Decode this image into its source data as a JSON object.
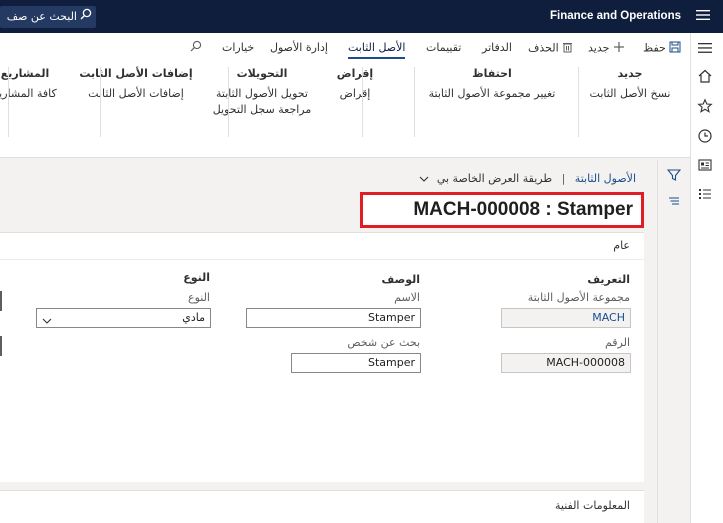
{
  "app": {
    "title": "Finance and Operations",
    "search_label": "البحث عن صف"
  },
  "tabs": [
    {
      "label": "حفظ"
    },
    {
      "label": "جديد"
    },
    {
      "label": "الحذف"
    },
    {
      "label": "الدفاتر"
    },
    {
      "label": "تقييمات"
    },
    {
      "label": "الأصل الثابت"
    },
    {
      "label": "إدارة الأصول"
    },
    {
      "label": "خيارات"
    }
  ],
  "ribbon": {
    "groups": [
      {
        "title": "جديد",
        "items": [
          "نسخ الأصل الثابت"
        ]
      },
      {
        "title": "احتفاظ",
        "items": [
          "تغيير مجموعة الأصول الثابتة"
        ]
      },
      {
        "title": "إقراض",
        "items": [
          "إقراض"
        ]
      },
      {
        "title": "التحويلات",
        "items": [
          "تحويل الأصول الثابتة",
          "مراجعة سجل التحويل"
        ]
      },
      {
        "title": "إضافات الأصل الثابت",
        "items": [
          "إضافات الأصل الثابت"
        ]
      },
      {
        "title": "المشاريع",
        "items": [
          "كافة المشاريع"
        ]
      }
    ]
  },
  "breadcrumb": {
    "root": "الأصول الثابتة",
    "view": "طريقة العرض الخاصة بي"
  },
  "record_title": "MACH-000008 : Stamper",
  "general": {
    "header": "عام",
    "identification": {
      "title": "التعريف",
      "group_label": "مجموعة الأصول الثابتة",
      "group_value": "MACH",
      "number_label": "الرقم",
      "number_value": "MACH-000008"
    },
    "description": {
      "title": "الوصف",
      "name_label": "الاسم",
      "name_value": "Stamper",
      "search_label": "بحث عن شخص",
      "search_value": "Stamper"
    },
    "type": {
      "title": "النوع",
      "type_label": "النوع",
      "type_value": "مادي"
    }
  },
  "technical": {
    "header": "المعلومات الفنية"
  }
}
